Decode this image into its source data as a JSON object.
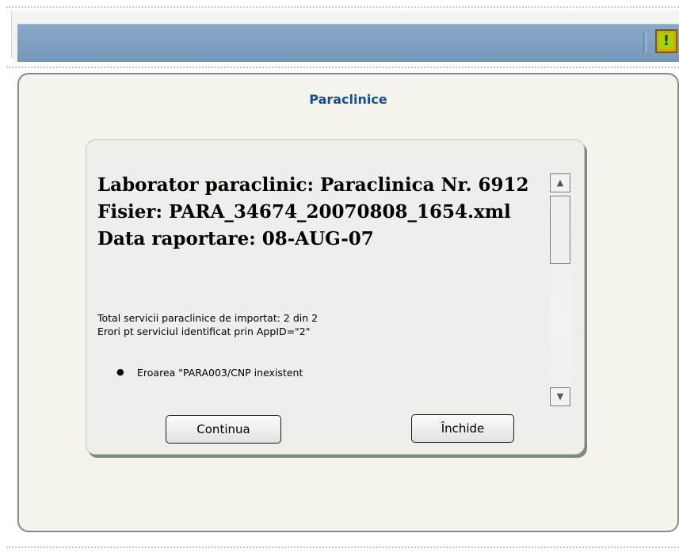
{
  "panel": {
    "title": "Paraclinice"
  },
  "toolbar": {
    "warning_icon_glyph": "!"
  },
  "dialog": {
    "laborator": "Laborator paraclinic: Paraclinica Nr. 6912",
    "fisier": "Fisier: PARA_34674_20070808_1654.xml",
    "data": "Data raportare: 08-AUG-07",
    "total": "Total servicii paraclinice de importat: 2 din 2",
    "erori": "Erori pt serviciul identificat prin AppID=\"2\"",
    "eroare_item": "Eroarea \"PARA003/CNP inexistent",
    "scroll_up_glyph": "▲",
    "scroll_down_glyph": "▼",
    "continua_label": "Continua",
    "inchide_label": "Închide"
  },
  "colors": {
    "titlebar": "#7698bb",
    "panel_title": "#1a4d8f",
    "warning_icon": "#a7d400"
  }
}
